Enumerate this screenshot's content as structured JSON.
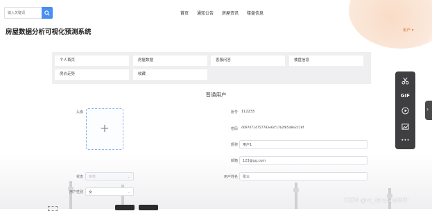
{
  "search": {
    "placeholder": "输入关键词"
  },
  "nav": [
    "首页",
    "通知公告",
    "房屋资讯",
    "楼盘信息"
  ],
  "app_title": "房屋数据分析可视化预测系统",
  "user_menu": "用户 ▾",
  "menu_items": [
    "个人首页",
    "房屋数据",
    "客服问答",
    "楼盘信息",
    "房价走势",
    "收藏"
  ],
  "form": {
    "title": "普通用户",
    "avatar_label": "头像",
    "account_label": "账号",
    "account_value": "112233",
    "password_label": "密码",
    "password_value": "d0970714757783e6cf17b2f85d8e2218f",
    "nickname_label": "昵称",
    "nickname_value": "用户1",
    "email_label": "邮箱",
    "email_value": "123@qq.com",
    "status_label": "状态",
    "status_value": "审核",
    "realname_label": "用户姓名",
    "realname_value": "张三",
    "gender_label": "用户性别",
    "gender_value": "女"
  },
  "toolbar": {
    "icons": [
      "scissors-icon",
      "gif-icon",
      "play-icon",
      "image-icon",
      "more-icon"
    ],
    "gif_text": "GIF",
    "more_text": "•••"
  },
  "watermark": "CSDN @vx_danpianji889",
  "colors": {
    "accent": "#4b8ef1",
    "brand_orange": "#e07a3b",
    "toolbar": "#3f3f42"
  }
}
